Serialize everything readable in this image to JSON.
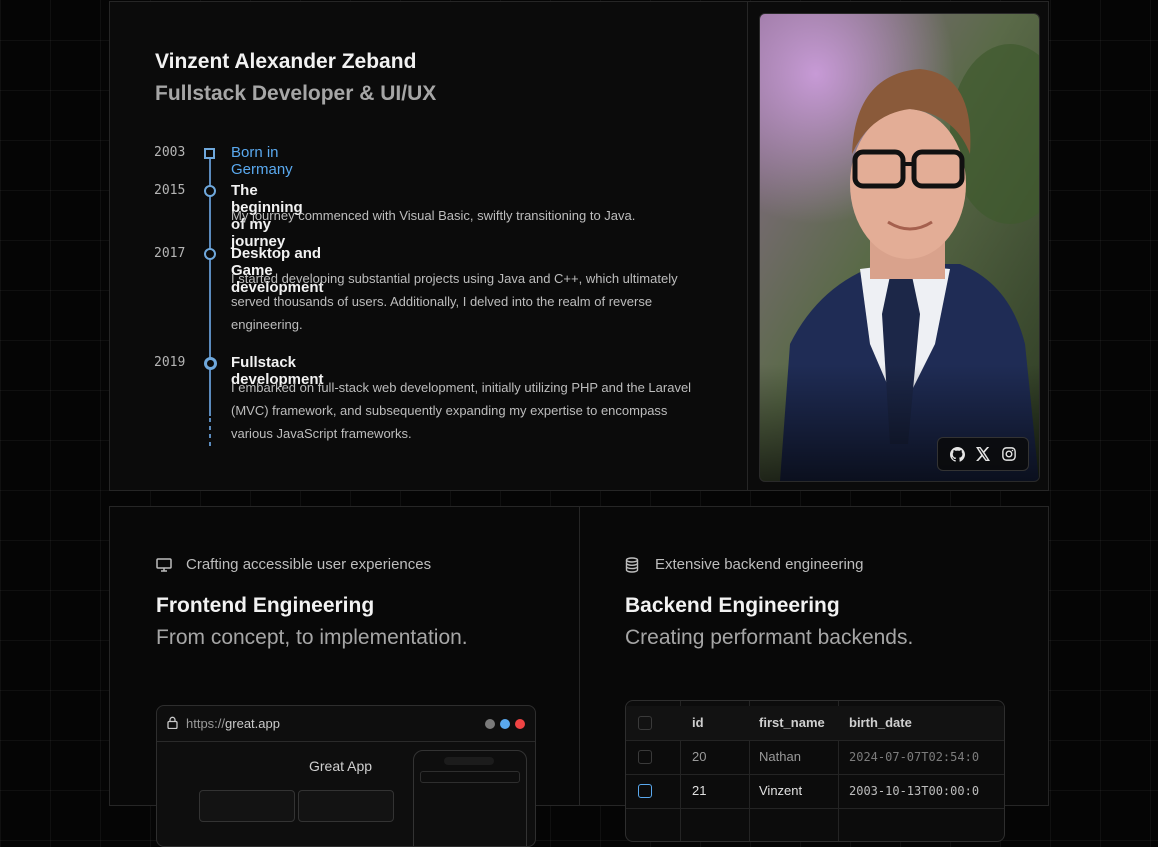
{
  "profile": {
    "name": "Vinzent Alexander Zeband",
    "role": "Fullstack Developer & UI/UX"
  },
  "timeline": [
    {
      "year": "2003",
      "title": "Born in Germany",
      "desc": ""
    },
    {
      "year": "2015",
      "title": "The beginning of my journey",
      "desc": "My journey commenced with Visual Basic, swiftly transitioning to Java."
    },
    {
      "year": "2017",
      "title": "Desktop and Game development",
      "desc": "I started developing substantial projects using Java and C++, which ultimately served thousands of users. Additionally, I delved into the realm of reverse engineering."
    },
    {
      "year": "2019",
      "title": "Fullstack development",
      "desc": "I embarked on full-stack web development, initially utilizing PHP and the Laravel (MVC) framework, and subsequently expanding my expertise to encompass various JavaScript frameworks."
    }
  ],
  "socials": [
    {
      "icon": "github-icon"
    },
    {
      "icon": "x-icon"
    },
    {
      "icon": "instagram-icon"
    }
  ],
  "frontend": {
    "tag": "Crafting accessible user experiences",
    "tag_icon": "monitor-icon",
    "title": "Frontend Engineering",
    "subtitle": "From concept, to implementation.",
    "browser": {
      "url_prefix": "https://",
      "url_host": "great.app",
      "app_title": "Great App",
      "dot_colors": [
        "#7a7a7a",
        "#5aa9ef",
        "#ef4444"
      ]
    }
  },
  "backend": {
    "tag": "Extensive backend engineering",
    "tag_icon": "database-icon",
    "title": "Backend Engineering",
    "subtitle": "Creating performant backends.",
    "table": {
      "columns": [
        "id",
        "first_name",
        "birth_date"
      ],
      "rows": [
        [
          "20",
          "Nathan",
          "2024-07-07T02:54:0"
        ],
        [
          "21",
          "Vinzent",
          "2003-10-13T00:00:0"
        ]
      ]
    }
  },
  "colors": {
    "accent": "#5aa9ef",
    "timeline_line": "#5b8bbd"
  }
}
